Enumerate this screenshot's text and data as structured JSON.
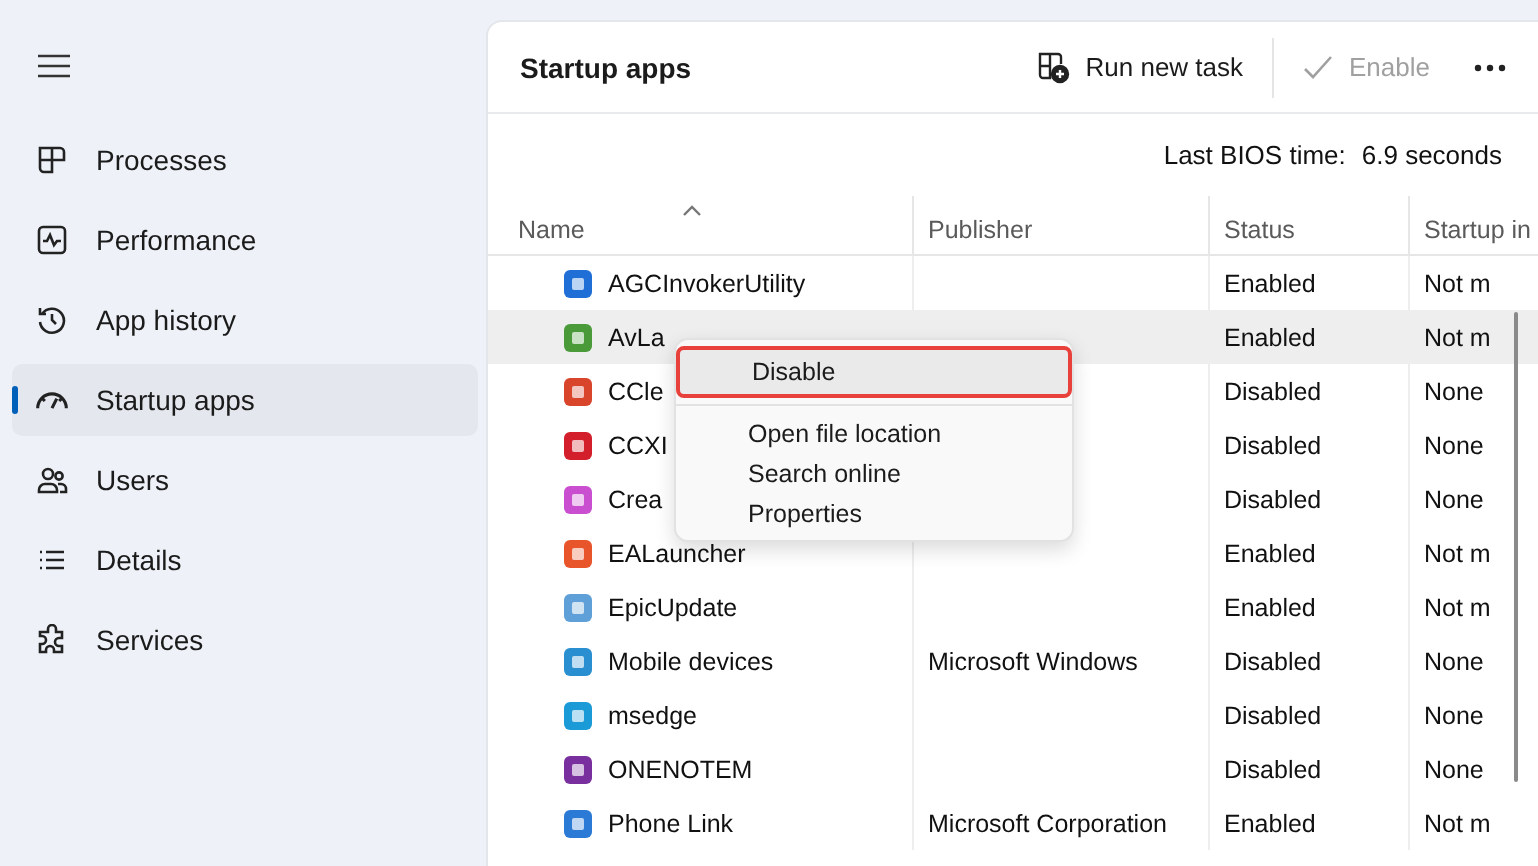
{
  "sidebar": {
    "items": [
      {
        "label": "Processes",
        "selected": false
      },
      {
        "label": "Performance",
        "selected": false
      },
      {
        "label": "App history",
        "selected": false
      },
      {
        "label": "Startup apps",
        "selected": true
      },
      {
        "label": "Users",
        "selected": false
      },
      {
        "label": "Details",
        "selected": false
      },
      {
        "label": "Services",
        "selected": false
      }
    ]
  },
  "header": {
    "title": "Startup apps",
    "run_new_task": "Run new task",
    "enable": {
      "label": "Enable",
      "disabled": true
    }
  },
  "bios": {
    "label": "Last BIOS time:",
    "value": "6.9 seconds"
  },
  "table": {
    "columns": [
      "Name",
      "Publisher",
      "Status",
      "Startup in"
    ],
    "rows": [
      {
        "name": "AGCInvokerUtility",
        "publisher": "",
        "status": "Enabled",
        "impact": "Not m",
        "selected": false
      },
      {
        "name": "AvLa",
        "publisher": "",
        "status": "Enabled",
        "impact": "Not m",
        "selected": true
      },
      {
        "name": "CCle",
        "publisher": "",
        "status": "Disabled",
        "impact": "None",
        "selected": false
      },
      {
        "name": "CCXI",
        "publisher": "",
        "status": "Disabled",
        "impact": "None",
        "selected": false
      },
      {
        "name": "Crea",
        "publisher": "",
        "status": "Disabled",
        "impact": "None",
        "selected": false
      },
      {
        "name": "EALauncher",
        "publisher": "",
        "status": "Enabled",
        "impact": "Not m",
        "selected": false
      },
      {
        "name": "EpicUpdate",
        "publisher": "",
        "status": "Enabled",
        "impact": "Not m",
        "selected": false
      },
      {
        "name": "Mobile devices",
        "publisher": "Microsoft Windows",
        "status": "Disabled",
        "impact": "None",
        "selected": false
      },
      {
        "name": "msedge",
        "publisher": "",
        "status": "Disabled",
        "impact": "None",
        "selected": false
      },
      {
        "name": "ONENOTEM",
        "publisher": "",
        "status": "Disabled",
        "impact": "None",
        "selected": false
      },
      {
        "name": "Phone Link",
        "publisher": "Microsoft Corporation",
        "status": "Enabled",
        "impact": "Not m",
        "selected": false
      }
    ]
  },
  "context_menu": {
    "items": [
      {
        "label": "Disable",
        "highlighted": true,
        "outlined": true
      },
      {
        "label": "Open file location",
        "highlighted": false,
        "outlined": false
      },
      {
        "label": "Search online",
        "highlighted": false,
        "outlined": false
      },
      {
        "label": "Properties",
        "highlighted": false,
        "outlined": false
      }
    ]
  }
}
